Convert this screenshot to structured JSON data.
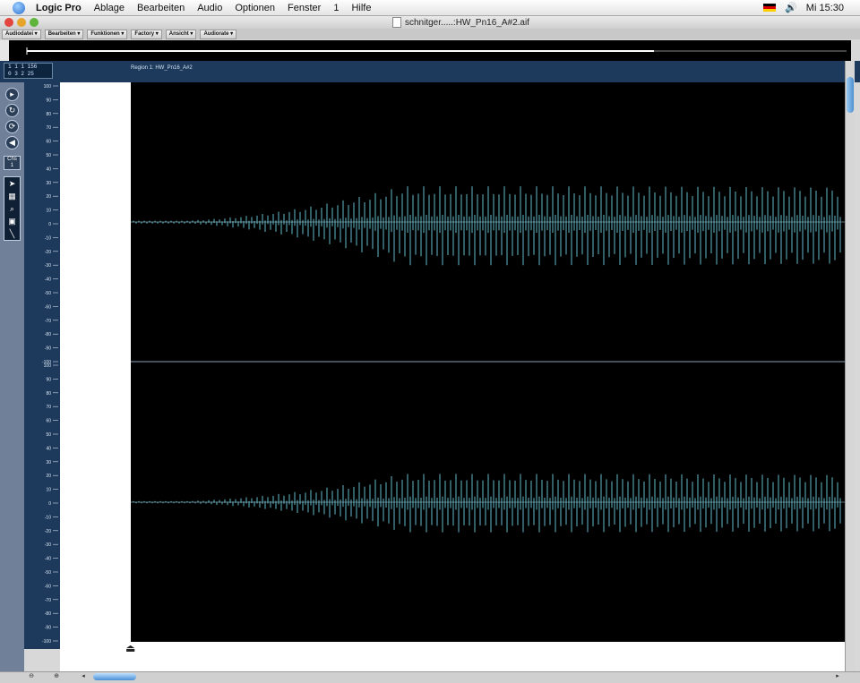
{
  "menubar": {
    "app_name": "Logic Pro",
    "items": [
      "Ablage",
      "Bearbeiten",
      "Audio",
      "Optionen",
      "Fenster",
      "1",
      "Hilfe"
    ],
    "clock": "Mi 15:30"
  },
  "window": {
    "title": "schnitger.....:HW_Pn16_A#2.aif"
  },
  "local_menus": [
    "Audiodatei ▾",
    "Bearbeiten ▾",
    "Funktionen ▾",
    "Factory ▾",
    "Ansicht ▾",
    "Audiorate ▾"
  ],
  "position_display": {
    "line1": "1  1  1  156",
    "line2": "0  3  2  25"
  },
  "region_label": "Region 1: HW_Pn16_A#2",
  "tools": {
    "chs_label": "Chs",
    "chs_value": "1"
  },
  "ruler": {
    "ticks": [
      100,
      90,
      80,
      70,
      60,
      50,
      40,
      30,
      20,
      10,
      0,
      -10,
      -20,
      -30,
      -40,
      -50,
      -60,
      -70,
      -80,
      -90,
      -100
    ]
  },
  "colors": {
    "waveform": "#6fd0e0",
    "background": "#000000",
    "ruler_bg": "#1d3a5c"
  }
}
